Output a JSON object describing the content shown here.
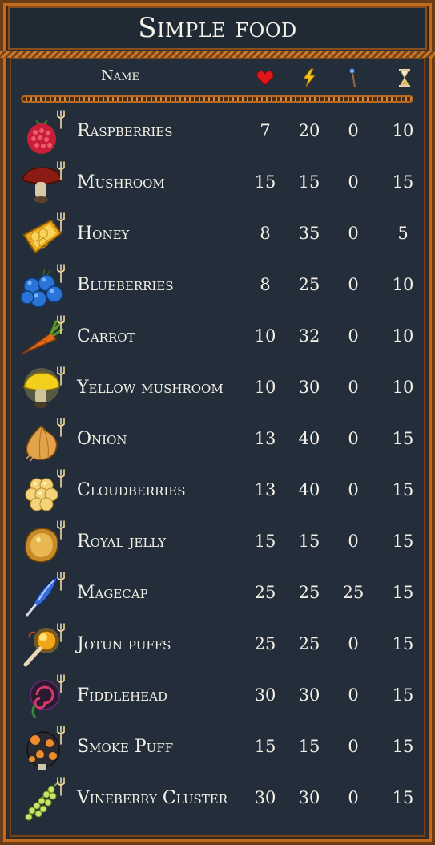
{
  "title": "Simple food",
  "header": {
    "name_label": "Name",
    "health_icon": "heart-icon",
    "stamina_icon": "lightning-icon",
    "eitr_icon": "magic-staff-icon",
    "duration_icon": "hourglass-icon"
  },
  "colors": {
    "background": "#26313d",
    "border": "#c06a22",
    "text": "#f4f1e8",
    "heart": "#e0161b",
    "lightning": "#f5c51c"
  },
  "foods": [
    {
      "name": "Raspberries",
      "icon": "raspberry-icon",
      "health": "7",
      "stamina": "20",
      "eitr": "0",
      "duration": "10"
    },
    {
      "name": "Mushroom",
      "icon": "mushroom-icon",
      "health": "15",
      "stamina": "15",
      "eitr": "0",
      "duration": "15"
    },
    {
      "name": "Honey",
      "icon": "honey-icon",
      "health": "8",
      "stamina": "35",
      "eitr": "0",
      "duration": "5"
    },
    {
      "name": "Blueberries",
      "icon": "blueberries-icon",
      "health": "8",
      "stamina": "25",
      "eitr": "0",
      "duration": "10"
    },
    {
      "name": "Carrot",
      "icon": "carrot-icon",
      "health": "10",
      "stamina": "32",
      "eitr": "0",
      "duration": "10"
    },
    {
      "name": "Yellow mushroom",
      "icon": "yellow-mushroom-icon",
      "health": "10",
      "stamina": "30",
      "eitr": "0",
      "duration": "10"
    },
    {
      "name": "Onion",
      "icon": "onion-icon",
      "health": "13",
      "stamina": "40",
      "eitr": "0",
      "duration": "15"
    },
    {
      "name": "Cloudberries",
      "icon": "cloudberries-icon",
      "health": "13",
      "stamina": "40",
      "eitr": "0",
      "duration": "15"
    },
    {
      "name": "Royal jelly",
      "icon": "royal-jelly-icon",
      "health": "15",
      "stamina": "15",
      "eitr": "0",
      "duration": "15"
    },
    {
      "name": "Magecap",
      "icon": "magecap-icon",
      "health": "25",
      "stamina": "25",
      "eitr": "25",
      "duration": "15"
    },
    {
      "name": "Jotun puffs",
      "icon": "jotun-puffs-icon",
      "health": "25",
      "stamina": "25",
      "eitr": "0",
      "duration": "15"
    },
    {
      "name": "Fiddlehead",
      "icon": "fiddlehead-icon",
      "health": "30",
      "stamina": "30",
      "eitr": "0",
      "duration": "15"
    },
    {
      "name": "Smoke Puff",
      "icon": "smoke-puff-icon",
      "health": "15",
      "stamina": "15",
      "eitr": "0",
      "duration": "15"
    },
    {
      "name": "Vineberry Cluster",
      "icon": "vineberry-cluster-icon",
      "health": "30",
      "stamina": "30",
      "eitr": "0",
      "duration": "15"
    }
  ]
}
